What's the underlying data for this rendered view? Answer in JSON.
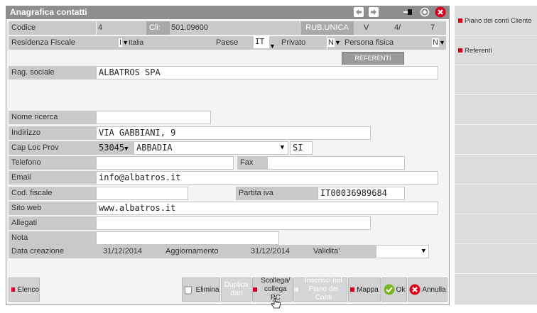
{
  "window": {
    "title": "Anagrafica contatti"
  },
  "header": {
    "codice_label": "Codice",
    "codice_value": "4",
    "cli_label": "Cli:",
    "cli_value": "501.09600",
    "rub_label": "RUB.UNICA",
    "rub_v": "V",
    "rub_n": "4/",
    "rub_total": "7"
  },
  "row2": {
    "residenza_label": "Residenza Fiscale",
    "residenza_code": "I",
    "residenza_value": "Italia",
    "paese_label": "Paese",
    "paese_value": "IT",
    "privato_label": "Privato",
    "privato_value": "N",
    "persona_label": "Persona fisica",
    "persona_value": "N"
  },
  "referenti_button": "REFERENTI",
  "form": {
    "rag_sociale_label": "Rag. sociale",
    "rag_sociale_value": "ALBATROS SPA",
    "nome_ricerca_label": "Nome ricerca",
    "nome_ricerca_value": "",
    "indirizzo_label": "Indirizzo",
    "indirizzo_value": "VIA GABBIANI, 9",
    "cap_label": "Cap Loc Prov",
    "cap_value": "53045",
    "loc_value": "ABBADIA",
    "prov_value": "SI",
    "telefono_label": "Telefono",
    "telefono_value": "",
    "fax_label": "Fax",
    "fax_value": "",
    "email_label": "Email",
    "email_value": "info@albatros.it",
    "cod_fiscale_label": "Cod. fiscale",
    "cod_fiscale_value": "",
    "piva_label": "Partita iva",
    "piva_value": "IT00036989684",
    "sito_label": "Sito web",
    "sito_value": "www.albatros.it",
    "allegati_label": "Allegati",
    "allegati_value": "",
    "nota_label": "Nota",
    "nota_value": "",
    "data_creazione_label": "Data creazione",
    "data_creazione_value": "31/12/2014",
    "aggiornamento_label": "Aggiornamento",
    "aggiornamento_value": "31/12/2014",
    "validita_label": "Validita'",
    "validita_value": ""
  },
  "toolbar": {
    "elenco": "Elenco",
    "elimina": "Elimina",
    "duplica_1": "Duplica",
    "duplica_2": "dati",
    "scollega_1": "Scollega/",
    "scollega_2": "collega PC",
    "inserisci_1": "Inserisci nel",
    "inserisci_2": "Piano dei Conti",
    "mappa": "Mappa",
    "ok": "Ok",
    "annulla": "Annulla"
  },
  "sidebar": {
    "items": [
      {
        "label": "Piano dei conti Cliente"
      },
      {
        "label": "Referenti"
      }
    ]
  },
  "colors": {
    "accent_red": "#d9001b",
    "ok_green": "#7ab51d",
    "title_bar": "#8e8e8e"
  }
}
